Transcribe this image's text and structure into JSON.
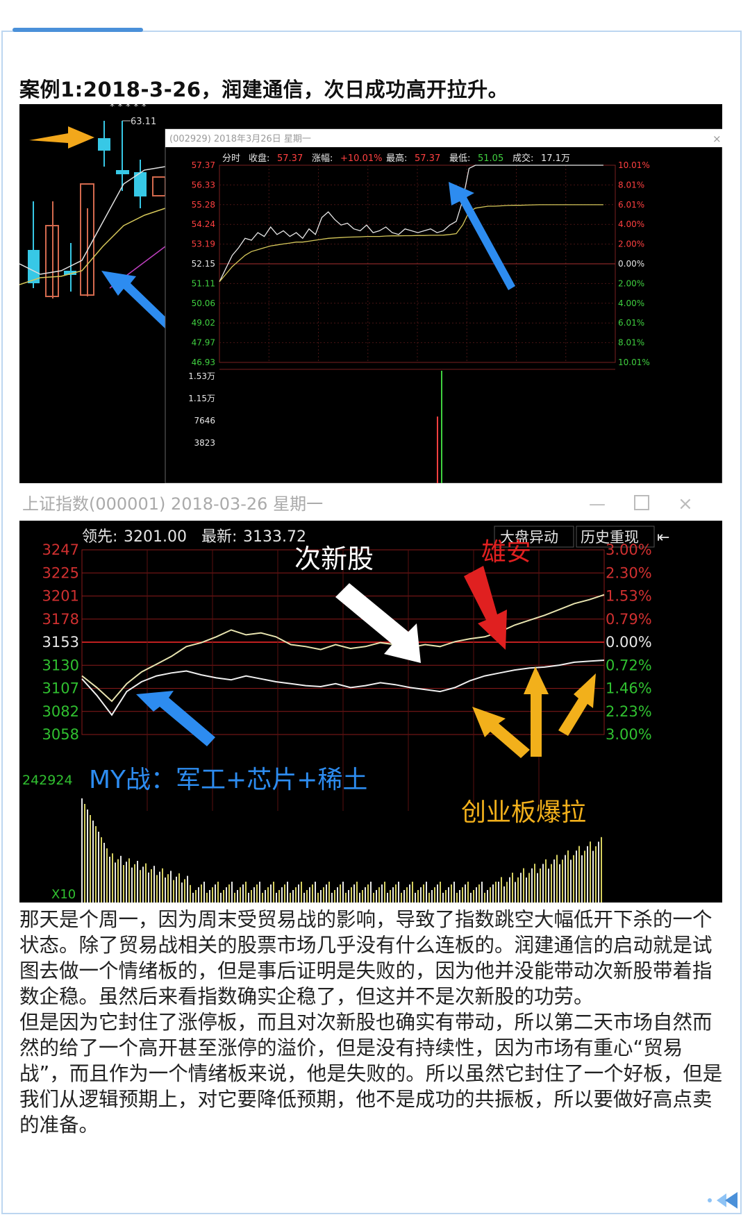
{
  "heading": "案例1:2018-3-26，润建通信，次日成功高开拉升。",
  "chart_data": [
    {
      "type": "line",
      "kline_peak_label": "63.11",
      "popup_title": "(002929) 2018年3月26日 星期一",
      "info_bar": [
        {
          "label": "分时",
          "value": "",
          "color": "#e8e8e8"
        },
        {
          "label": "收盘:",
          "value": "57.37",
          "color": "#ff4040"
        },
        {
          "label": "涨幅:",
          "value": "+10.01%",
          "color": "#ff4040"
        },
        {
          "label": "最高:",
          "value": "57.37",
          "color": "#ff4040"
        },
        {
          "label": "最低:",
          "value": "51.05",
          "color": "#40d040"
        },
        {
          "label": "成交:",
          "value": "17.1万",
          "color": "#e8e8e8"
        }
      ],
      "price_ticks": [
        "57.37",
        "56.33",
        "55.28",
        "54.24",
        "53.19",
        "52.15",
        "51.11",
        "50.06",
        "49.02",
        "47.97",
        "46.93"
      ],
      "pct_ticks": [
        "10.01%",
        "8.01%",
        "6.01%",
        "4.00%",
        "2.00%",
        "0.00%",
        "2.00%",
        "4.00%",
        "6.01%",
        "8.01%",
        "10.01%"
      ],
      "volume_ticks": [
        "1.53万",
        "1.15万",
        "7646",
        "3823"
      ],
      "ylim": [
        46.93,
        57.37
      ],
      "prev_close": 52.15,
      "series": [
        {
          "values": [
            51.2,
            51.9,
            52.6,
            53.0,
            53.5,
            53.4,
            53.8,
            53.6,
            54.1,
            53.7,
            53.9,
            53.6,
            53.8,
            53.5,
            54.0,
            53.7,
            54.6,
            54.9,
            54.5,
            54.2,
            54.3,
            54.0,
            53.9,
            54.2,
            53.8,
            53.9,
            54.1,
            53.8,
            53.7,
            54.0,
            53.9,
            53.8,
            53.9,
            54.0,
            53.8,
            53.9,
            54.2,
            54.4,
            55.5,
            57.2,
            57.37,
            57.37,
            57.37,
            57.37,
            57.37,
            57.37,
            57.37,
            57.37,
            57.37,
            57.37,
            57.37,
            57.37,
            57.37,
            57.37,
            57.37,
            57.37,
            57.37,
            57.37,
            57.37,
            57.37,
            57.37
          ]
        },
        {
          "values": [
            51.2,
            51.6,
            52.0,
            52.3,
            52.6,
            52.8,
            52.9,
            53.0,
            53.1,
            53.15,
            53.2,
            53.25,
            53.3,
            53.3,
            53.35,
            53.4,
            53.45,
            53.5,
            53.52,
            53.54,
            53.56,
            53.57,
            53.58,
            53.6,
            53.6,
            53.6,
            53.62,
            53.63,
            53.63,
            53.64,
            53.64,
            53.65,
            53.65,
            53.66,
            53.66,
            53.67,
            53.7,
            53.75,
            54.2,
            54.9,
            55.1,
            55.15,
            55.2,
            55.2,
            55.22,
            55.24,
            55.25,
            55.25,
            55.26,
            55.27,
            55.28,
            55.28,
            55.28,
            55.28,
            55.28,
            55.28,
            55.28,
            55.28,
            55.28,
            55.28,
            55.28
          ]
        }
      ]
    },
    {
      "type": "line",
      "window_title": "上证指数(000001) 2018-03-26 星期一",
      "info_label_lead": "领先:",
      "info_value_lead": "3201.00",
      "info_label_latest": "最新:",
      "info_value_latest": "3133.72",
      "buttons": [
        "大盘异动",
        "历史重现"
      ],
      "price_ticks": [
        "3247",
        "3225",
        "3201",
        "3178",
        "3153",
        "3130",
        "3107",
        "3082",
        "3058"
      ],
      "pct_ticks": [
        "3.00%",
        "2.30%",
        "1.53%",
        "0.79%",
        "0.00%",
        "0.72%",
        "1.46%",
        "2.23%",
        "3.00%"
      ],
      "volume_label": "242924",
      "volume_unit": "X10",
      "ylim": [
        3058,
        3247
      ],
      "prev_close": 3153,
      "annotations": {
        "sub_new": "次新股",
        "xiongan": "雄安",
        "trade_war": "MY战：军工+芯片+稀土",
        "gem": "创业板爆拉"
      },
      "series": [
        {
          "name": "",
          "values": [
            3118,
            3106,
            3092,
            3110,
            3122,
            3130,
            3138,
            3148,
            3152,
            3158,
            3165,
            3160,
            3162,
            3158,
            3150,
            3148,
            3145,
            3150,
            3146,
            3148,
            3152,
            3150,
            3147,
            3150,
            3148,
            3153,
            3156,
            3158,
            3163,
            3170,
            3175,
            3180,
            3186,
            3192,
            3196,
            3201
          ]
        },
        {
          "name": "",
          "values": [
            3115,
            3098,
            3078,
            3102,
            3112,
            3118,
            3121,
            3123,
            3119,
            3116,
            3114,
            3118,
            3115,
            3112,
            3110,
            3108,
            3107,
            3110,
            3106,
            3108,
            3111,
            3109,
            3106,
            3104,
            3102,
            3106,
            3113,
            3118,
            3121,
            3124,
            3126,
            3127,
            3129,
            3132,
            3133,
            3134
          ]
        }
      ]
    }
  ],
  "paragraphs": [
    "那天是个周一，因为周末受贸易战的影响，导致了指数跳空大幅低开下杀的一个状态。除了贸易战相关的股票市场几乎没有什么连板的。润建通信的启动就是试图去做一个情绪板的，但是事后证明是失败的，因为他并没能带动次新股带着指数企稳。虽然后来看指数确实企稳了，但这并不是次新股的功劳。",
    "但是因为它封住了涨停板，而且对次新股也确实有带动，所以第二天市场自然而然的给了一个高开甚至涨停的溢价，但是没有持续性，因为市场有重心“贸易战”，而且作为一个情绪板来说，他是失败的。所以虽然它封住了一个好板，但是我们从逻辑预期上，对它要降低预期，他不是成功的共振板，所以要做好高点卖的准备。"
  ]
}
